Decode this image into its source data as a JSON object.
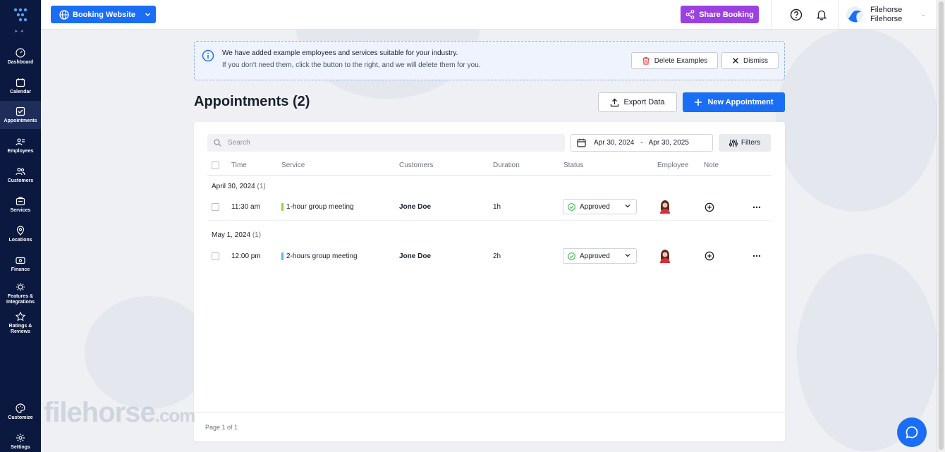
{
  "sidebar": {
    "items": [
      {
        "label": "Dashboard",
        "icon": "dashboard-icon"
      },
      {
        "label": "Calendar",
        "icon": "calendar-icon"
      },
      {
        "label": "Appointments",
        "icon": "appointments-icon"
      },
      {
        "label": "Employees",
        "icon": "employees-icon"
      },
      {
        "label": "Customers",
        "icon": "customers-icon"
      },
      {
        "label": "Services",
        "icon": "services-icon"
      },
      {
        "label": "Locations",
        "icon": "location-pin-icon"
      },
      {
        "label": "Finance",
        "icon": "finance-icon"
      },
      {
        "label": "Features & Integrations",
        "icon": "bulb-icon"
      },
      {
        "label": "Ratings & Reviews",
        "icon": "star-icon"
      },
      {
        "label": "Customize",
        "icon": "palette-icon"
      },
      {
        "label": "Settings",
        "icon": "gear-icon"
      }
    ],
    "active": "Appointments"
  },
  "topbar": {
    "booking_label": "Booking Website",
    "share_label": "Share Booking",
    "user_line1": "Filehorse",
    "user_line2": "Filehorse"
  },
  "notice": {
    "title": "We have added example employees and services suitable for your industry.",
    "subtitle": "If you don't need them, click the button to the right, and we will delete them for you.",
    "delete_label": "Delete Examples",
    "dismiss_label": "Dismiss"
  },
  "page": {
    "title": "Appointments (2)",
    "export_label": "Export Data",
    "new_label": "New Appointment"
  },
  "toolbar": {
    "search_placeholder": "Search",
    "date_from": "Apr 30, 2024",
    "date_sep": "-",
    "date_to": "Apr 30, 2025",
    "filters_label": "Filters"
  },
  "table": {
    "columns": [
      "Time",
      "Service",
      "Customers",
      "Duration",
      "Status",
      "Employee",
      "Note"
    ],
    "groups": [
      {
        "date": "April 30, 2024",
        "count": "(1)",
        "rows": [
          {
            "time": "11:30 am",
            "service": "1-hour group meeting",
            "service_color": "#8fd14f",
            "customer": "Jone Doe",
            "duration": "1h",
            "status": "Approved"
          }
        ]
      },
      {
        "date": "May 1, 2024",
        "count": "(1)",
        "rows": [
          {
            "time": "12:00 pm",
            "service": "2-hours group meeting",
            "service_color": "#5bb8f5",
            "customer": "Jone Doe",
            "duration": "2h",
            "status": "Approved"
          }
        ]
      }
    ],
    "pagination": "Page 1 of 1"
  },
  "watermark": {
    "main": "filehorse",
    "suffix": ".com"
  },
  "colors": {
    "primary": "#1a6ef5",
    "share": "#9b41e0",
    "sidebar": "#0b1940",
    "approved": "#3fb950"
  }
}
